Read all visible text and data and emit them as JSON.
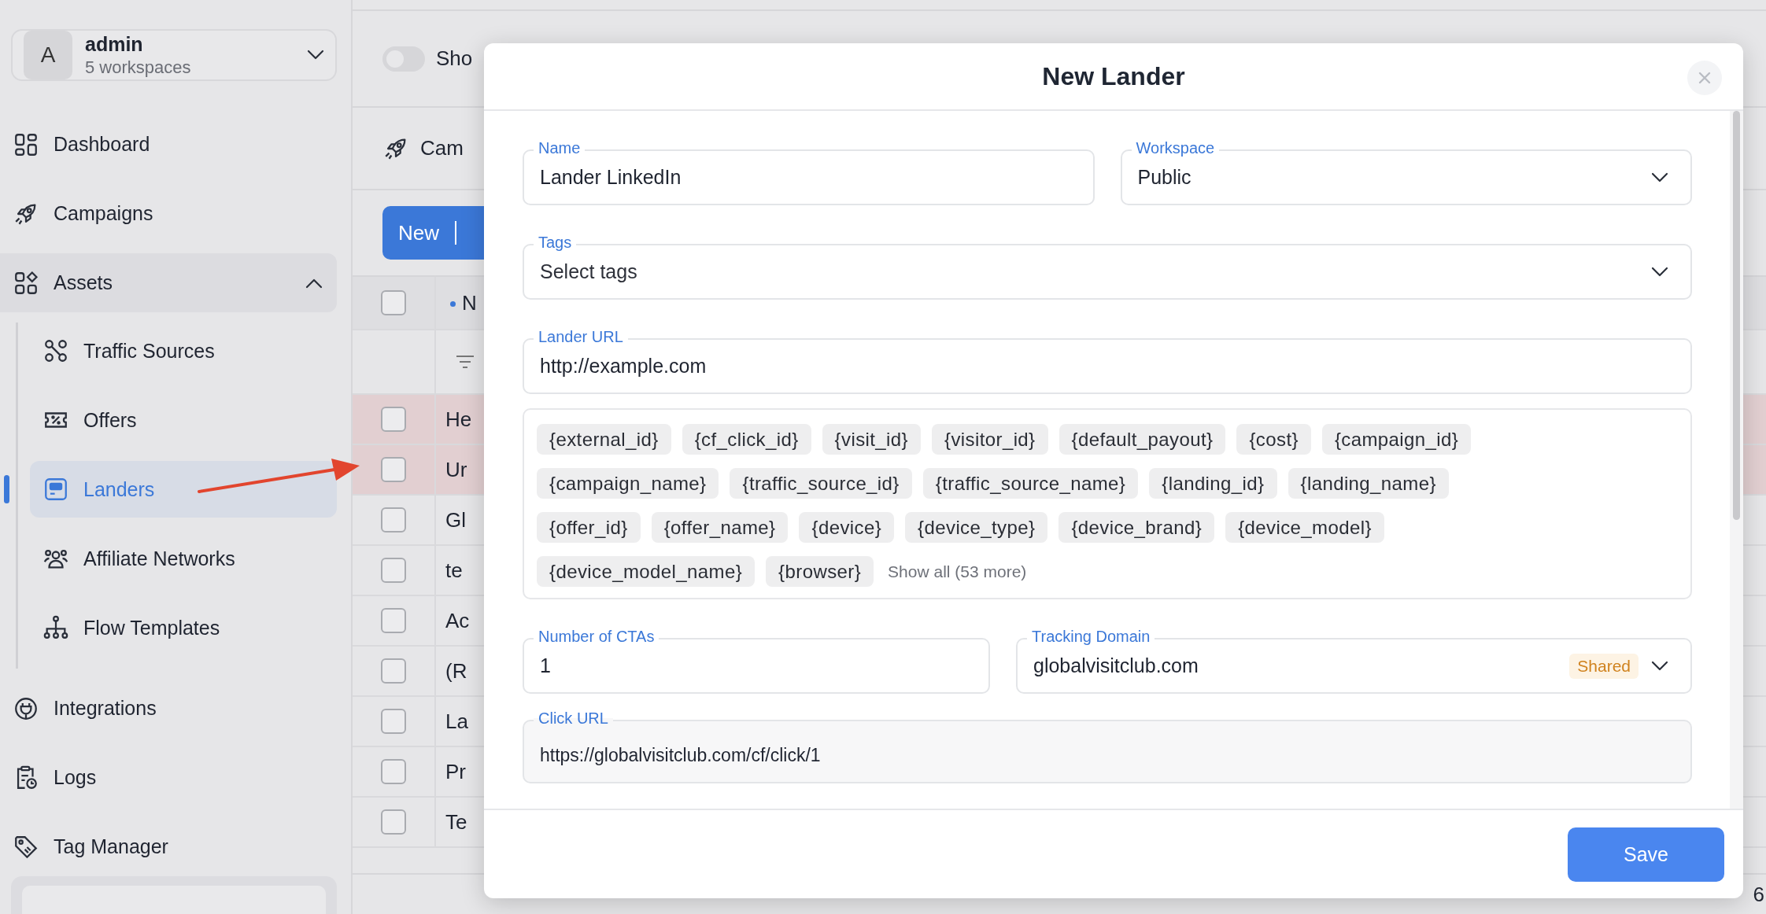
{
  "user": {
    "initial": "A",
    "name": "admin",
    "subtitle": "5 workspaces"
  },
  "sidebar": {
    "items": [
      {
        "label": "Dashboard",
        "selected": false
      },
      {
        "label": "Campaigns",
        "selected": false
      },
      {
        "label": "Assets",
        "selected": false,
        "expanded": true,
        "children": [
          {
            "label": "Traffic Sources",
            "selected": false
          },
          {
            "label": "Offers",
            "selected": false
          },
          {
            "label": "Landers",
            "selected": true
          },
          {
            "label": "Affiliate Networks",
            "selected": false
          },
          {
            "label": "Flow Templates",
            "selected": false
          }
        ]
      },
      {
        "label": "Integrations",
        "selected": false
      },
      {
        "label": "Logs",
        "selected": false
      },
      {
        "label": "Tag Manager",
        "selected": false
      }
    ]
  },
  "background": {
    "toggle": {
      "label": "Sho",
      "on": false
    },
    "tab_label": "Cam",
    "new_button": "New",
    "column_header": "N",
    "all_checked": false,
    "rows": [
      {
        "text": "He",
        "highlighted": true,
        "checked": false
      },
      {
        "text": "Ur",
        "highlighted": true,
        "checked": false
      },
      {
        "text": "Gl",
        "highlighted": false,
        "checked": false
      },
      {
        "text": "te",
        "highlighted": false,
        "checked": false
      },
      {
        "text": "Ac",
        "highlighted": false,
        "checked": false
      },
      {
        "text": "(R",
        "highlighted": false,
        "checked": false
      },
      {
        "text": "La",
        "highlighted": false,
        "checked": false
      },
      {
        "text": "Pr",
        "highlighted": false,
        "checked": false
      },
      {
        "text": "Te",
        "highlighted": false,
        "checked": false
      }
    ],
    "page_number": "6"
  },
  "modal": {
    "title": "New Lander",
    "sections": [
      {
        "kind": "fields",
        "fields": [
          {
            "kind": "text",
            "label": "Name",
            "value": "Lander LinkedIn"
          },
          {
            "kind": "select",
            "label": "Workspace",
            "value": "Public"
          }
        ]
      },
      {
        "kind": "fields",
        "fields": [
          {
            "kind": "select",
            "label": "Tags",
            "placeholder": "Select tags"
          }
        ]
      },
      {
        "kind": "fields",
        "fields": [
          {
            "kind": "text",
            "label": "Lander URL",
            "value": "http://example.com"
          }
        ]
      },
      {
        "kind": "variables",
        "token_rows": [
          [
            "{external_id}",
            "{cf_click_id}",
            "{visit_id}",
            "{visitor_id}",
            "{default_payout}",
            "{cost}",
            "{campaign_id}"
          ],
          [
            "{campaign_name}",
            "{traffic_source_id}",
            "{traffic_source_name}",
            "{landing_id}",
            "{landing_name}"
          ],
          [
            "{offer_id}",
            "{offer_name}",
            "{device}",
            "{device_type}",
            "{device_brand}",
            "{device_model}"
          ],
          [
            "{device_model_name}",
            "{browser}"
          ]
        ],
        "show_all": "Show all (53 more)"
      },
      {
        "kind": "fields",
        "fields": [
          {
            "kind": "text",
            "label": "Number of CTAs",
            "value": "1"
          },
          {
            "kind": "select",
            "label": "Tracking Domain",
            "value": "globalvisitclub.com",
            "badge": "Shared"
          }
        ]
      },
      {
        "kind": "fields",
        "fields": [
          {
            "kind": "readonly",
            "label": "Click URL",
            "value": "https://globalvisitclub.com/cf/click/1"
          }
        ]
      }
    ],
    "save_button": "Save"
  }
}
